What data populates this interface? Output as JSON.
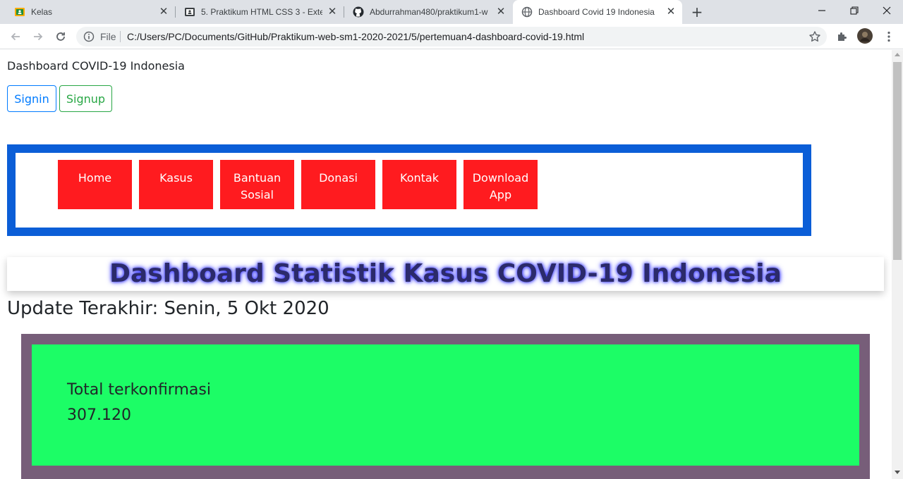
{
  "browser": {
    "tabs": [
      {
        "title": "Kelas",
        "icon": "classroom-icon",
        "active": false
      },
      {
        "title": "5. Praktikum HTML CSS 3 - Extern",
        "icon": "classroom-assignment-icon",
        "active": false
      },
      {
        "title": "Abdurrahman480/praktikum1-w",
        "icon": "github-icon",
        "active": false
      },
      {
        "title": "Dashboard Covid 19 Indonesia",
        "icon": "globe-icon",
        "active": true
      }
    ],
    "address": {
      "scheme_label": "File",
      "url": "C:/Users/PC/Documents/GitHub/Praktikum-web-sm1-2020-2021/5/pertemuan4-dashboard-covid-19.html"
    }
  },
  "page": {
    "site_title": "Dashboard COVID-19 Indonesia",
    "buttons": {
      "signin": "Signin",
      "signup": "Signup"
    },
    "menu": [
      "Home",
      "Kasus",
      "Bantuan Sosial",
      "Donasi",
      "Kontak",
      "Download App"
    ],
    "headline": "Dashboard Statistik Kasus COVID-19 Indonesia",
    "update": "Update Terakhir: Senin, 5 Okt 2020",
    "stat": {
      "label": "Total terkonfirmasi",
      "value": "307.120"
    }
  },
  "colors": {
    "nav_border": "#0b5ed7",
    "menu_bg": "#ff1b1f",
    "stat_outer": "#775e79",
    "stat_inner": "#1cfd66",
    "signin": "#007bff",
    "signup": "#28a745"
  }
}
